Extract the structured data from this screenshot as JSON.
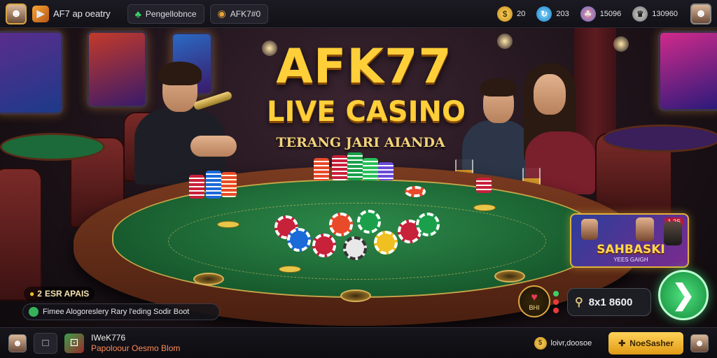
{
  "topbar": {
    "brand_label": "AF7 ap oeatry",
    "pill_1_label": "Pengellobnce",
    "pill_2_label": "AFK7#0",
    "stats": [
      {
        "icon": "coin-icon",
        "value": "20"
      },
      {
        "icon": "chip-icon",
        "value": "203"
      },
      {
        "icon": "gift-icon",
        "value": "15096"
      },
      {
        "icon": "trophy-icon",
        "value": "130960"
      }
    ]
  },
  "hero": {
    "title": "AFK77",
    "subtitle": "LIVE CASINO",
    "tagline": "TERANG JARI AIANDA"
  },
  "promo": {
    "badge": "1.2S",
    "title": "SAHBASKI",
    "subtitle": "YEES GAIGH"
  },
  "left_info": {
    "count": "2",
    "count_label": "ESR APAIS",
    "ticker": "Fimee Alogoreslery  Rary l'eding Sodir Boot"
  },
  "controls": {
    "reward_label": "BHI",
    "bet_value": "8x1 8600"
  },
  "bottombar": {
    "game_name": "IWeK776",
    "game_sub": "Papoloour Oesmo Blom",
    "wallet_label": "loivr,doosoe",
    "cta_label": "NoeSasher"
  },
  "colors": {
    "accent_gold": "#ffcf3a",
    "felt_green": "#2d8a4a",
    "play_green": "#4fe07e",
    "ticker_text": "#e6e6ea"
  }
}
